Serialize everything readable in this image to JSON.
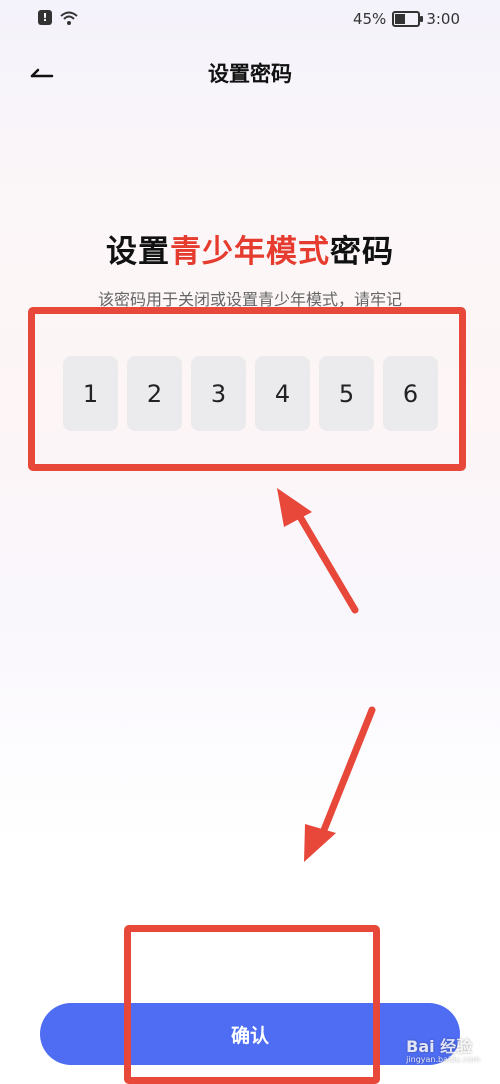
{
  "status_bar": {
    "battery": "45%",
    "time": "3:00"
  },
  "nav": {
    "title": "设置密码"
  },
  "headline": {
    "prefix": "设置",
    "accent": "青少年模式",
    "suffix": "密码"
  },
  "subtitle": "该密码用于关闭或设置青少年模式，请牢记",
  "pin_digits": [
    "1",
    "2",
    "3",
    "4",
    "5",
    "6"
  ],
  "confirm_button": {
    "label": "确认"
  },
  "watermark": {
    "brand": "Bai 经验",
    "url": "jingyan.baidu.com"
  },
  "colors": {
    "accent": "#e63c2f",
    "button": "#4f6df2",
    "annotation": "#e7483a"
  }
}
